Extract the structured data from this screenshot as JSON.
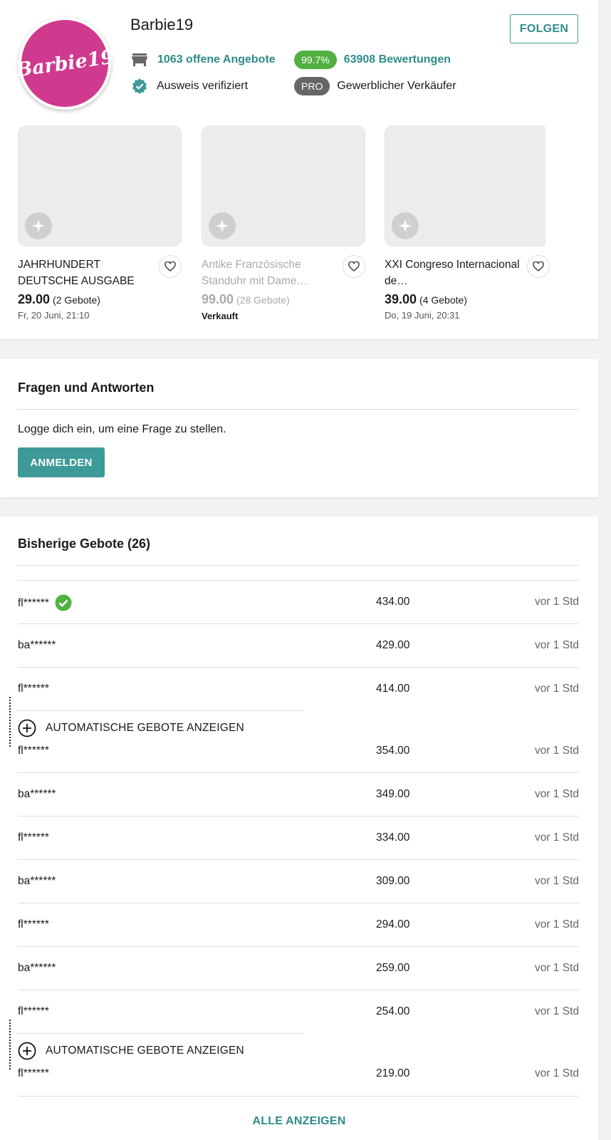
{
  "seller": {
    "avatar_text": "Barbie19",
    "name": "Barbie19",
    "follow_label": "FOLGEN",
    "offers": "1063 offene Angebote",
    "rating_percent": "99.7%",
    "reviews": "63908 Bewertungen",
    "verified": "Ausweis verifiziert",
    "pro_badge": "PRO",
    "seller_type": "Gewerblicher Verkäufer"
  },
  "products": [
    {
      "title": "JAHRHUNDERT DEUTSCHE AUSGABE MI…",
      "price": "29.00",
      "bids": "(2 Gebote)",
      "date": "Fr, 20 Juni, 21:10",
      "sold": ""
    },
    {
      "title": "Antike Französische Standuhr mit Dame…",
      "price": "99.00",
      "bids": "(28 Gebote)",
      "date": "",
      "sold": "Verkauft"
    },
    {
      "title": "XXI Congreso Internacional de…",
      "price": "39.00",
      "bids": "(4 Gebote)",
      "date": "Do, 19 Juni, 20:31",
      "sold": ""
    }
  ],
  "qa": {
    "title": "Fragen und Antworten",
    "prompt": "Logge dich ein, um eine Frage zu stellen.",
    "login_label": "ANMELDEN"
  },
  "bids": {
    "title": "Bisherige Gebote (26)",
    "auto_label": "AUTOMATISCHE GEBOTE ANZEIGEN",
    "show_all": "ALLE ANZEIGEN",
    "rows": [
      {
        "user": "fl******",
        "amount": "434.00",
        "time": "vor 1 Std"
      },
      {
        "user": "ba******",
        "amount": "429.00",
        "time": "vor 1 Std"
      },
      {
        "user": "fl******",
        "amount": "414.00",
        "time": "vor 1 Std"
      },
      {
        "user": "fl******",
        "amount": "354.00",
        "time": "vor 1 Std"
      },
      {
        "user": "ba******",
        "amount": "349.00",
        "time": "vor 1 Std"
      },
      {
        "user": "fl******",
        "amount": "334.00",
        "time": "vor 1 Std"
      },
      {
        "user": "ba******",
        "amount": "309.00",
        "time": "vor 1 Std"
      },
      {
        "user": "fl******",
        "amount": "294.00",
        "time": "vor 1 Std"
      },
      {
        "user": "ba******",
        "amount": "259.00",
        "time": "vor 1 Std"
      },
      {
        "user": "fl******",
        "amount": "254.00",
        "time": "vor 1 Std"
      },
      {
        "user": "fl******",
        "amount": "219.00",
        "time": "vor 1 Std"
      }
    ]
  },
  "colors": {
    "accent": "#3d9a98",
    "rating": "#52b043",
    "avatar": "#cf3a8f",
    "pro": "#666666"
  }
}
